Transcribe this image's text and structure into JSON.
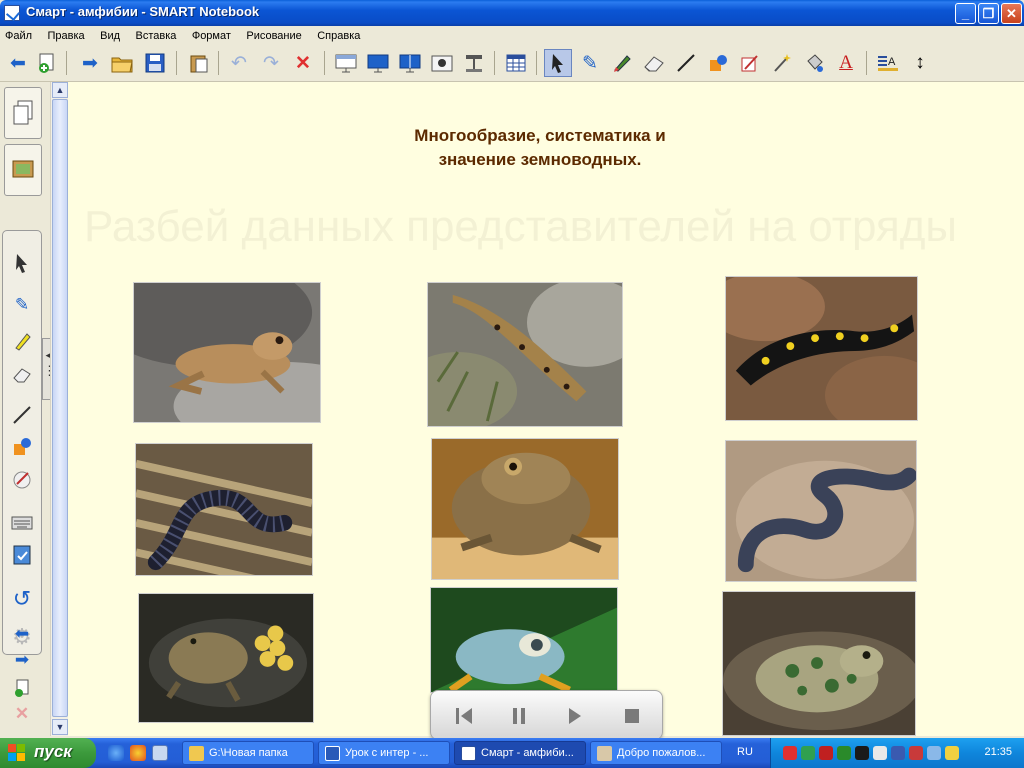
{
  "window": {
    "title": "Смарт - амфибии - SMART Notebook"
  },
  "menu": [
    "Файл",
    "Правка",
    "Вид",
    "Вставка",
    "Формат",
    "Рисование",
    "Справка"
  ],
  "toolbar": {
    "buttons": [
      "back",
      "add-page",
      "forward",
      "open",
      "save",
      "paste",
      "undo",
      "redo",
      "delete",
      "screen-shade",
      "full-screen",
      "dual-page",
      "screen-capture",
      "document-camera",
      "table",
      "select",
      "pen",
      "creative-pen",
      "eraser",
      "line",
      "shape",
      "magic-pen",
      "fill",
      "text",
      "properties",
      "move-toolbar"
    ]
  },
  "slide": {
    "heading_line1": "Многообразие, систематика и",
    "heading_line2": "значение земноводных.",
    "instruction": "Разбей данных представителей на отряды"
  },
  "photos": [
    "frog",
    "newt",
    "spotted-salamander",
    "caecilian",
    "toad",
    "caecilian-grey",
    "toad-with-eggs",
    "tree-frog",
    "green-toad"
  ],
  "player": [
    "previous",
    "pause",
    "play",
    "stop"
  ],
  "taskbar": {
    "start_label": "пуск",
    "tasks": [
      "G:\\Новая папка",
      "Урок с интер - ...",
      "Смарт - амфиби...",
      "Добро пожалов..."
    ],
    "language": "RU",
    "clock": "21:35"
  },
  "colors": {
    "accent": "#0a4cc6",
    "slide_bg": "#fffee0",
    "heading": "#5c2a00"
  }
}
